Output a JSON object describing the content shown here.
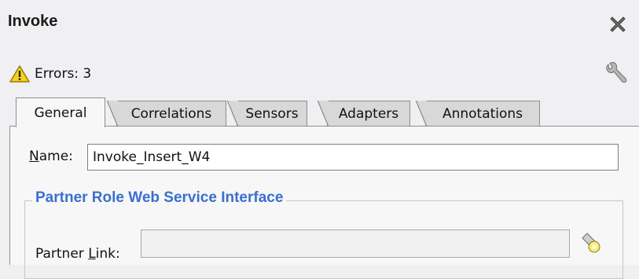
{
  "window": {
    "title": "Invoke"
  },
  "status": {
    "errors_label": "Errors: 3"
  },
  "tabs": [
    {
      "label": "General",
      "active": true
    },
    {
      "label": "Correlations",
      "active": false
    },
    {
      "label": "Sensors",
      "active": false
    },
    {
      "label": "Adapters",
      "active": false
    },
    {
      "label": "Annotations",
      "active": false
    }
  ],
  "general": {
    "name_label_first": "N",
    "name_label_rest": "ame:",
    "name_value": "Invoke_Insert_W4",
    "group_title": "Partner Role Web Service Interface",
    "partner_link_label_pre": "Partner ",
    "partner_link_label_mn": "L",
    "partner_link_label_post": "ink:",
    "partner_link_value": ""
  },
  "colors": {
    "background": "#f0eff2",
    "group_title": "#3a6fcf",
    "tab_inactive": "#d8d8d8",
    "warning": "#f5d31b"
  },
  "icons": [
    "close-icon",
    "warning-icon",
    "wrench-icon",
    "flashlight-icon"
  ]
}
